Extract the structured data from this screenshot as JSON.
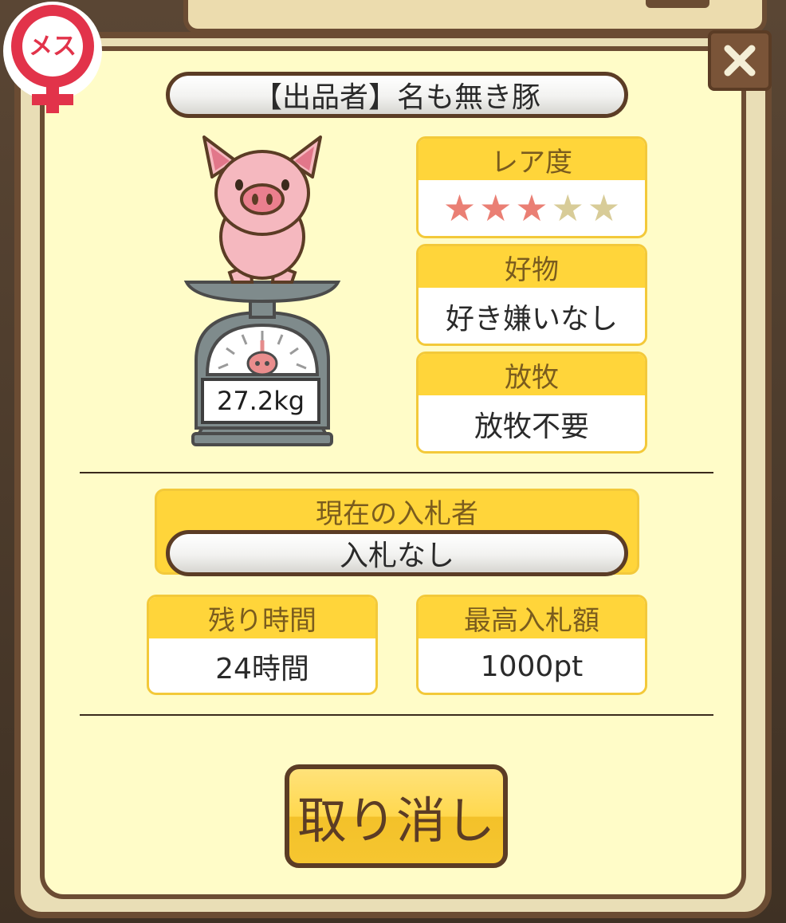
{
  "window": {
    "title": ""
  },
  "gender": {
    "label": "メス",
    "color": "#e2334a"
  },
  "seller": {
    "label": "【出品者】名も無き豚"
  },
  "pig": {
    "weight": "27.2kg",
    "icon": "pig-on-scale"
  },
  "rarity": {
    "label": "レア度",
    "filled": 3,
    "total": 5,
    "filled_color": "#ea7f74",
    "empty_color": "#d8cc98"
  },
  "food": {
    "label": "好物",
    "value": "好き嫌いなし"
  },
  "graze": {
    "label": "放牧",
    "value": "放牧不要"
  },
  "bidder": {
    "label": "現在の入札者",
    "value": "入札なし"
  },
  "remaining": {
    "label": "残り時間",
    "value": "24時間"
  },
  "max_bid": {
    "label": "最高入札額",
    "value": "1000pt"
  },
  "cancel": {
    "label": "取り消し"
  },
  "colors": {
    "frame": "#6b4c33",
    "panel": "#fffcc8",
    "header_yellow": "#ffd53a",
    "close": "#7a5438"
  }
}
